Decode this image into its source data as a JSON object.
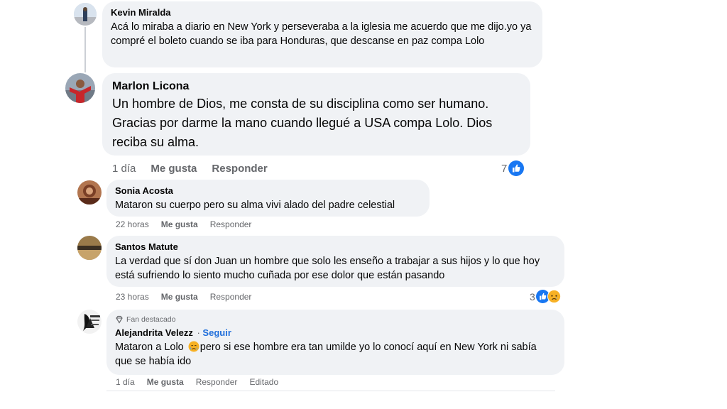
{
  "comments": [
    {
      "author": "Kevin Miralda",
      "text": "Acá lo miraba a diario en New York y perseveraba a la iglesia me acuerdo que me dijo.yo ya compré el boleto cuando se iba para Honduras, que descanse en paz compa Lolo"
    },
    {
      "author": "Marlon Licona",
      "text": "Un hombre de Dios, me consta de su disciplina como ser humano. Gracias por darme la mano cuando llegué a USA compa Lolo. Dios reciba su alma.",
      "time": "1 día",
      "like": "Me gusta",
      "reply": "Responder",
      "reaction_count": "7",
      "reaction_icons": [
        "like-icon"
      ]
    },
    {
      "author": "Sonia Acosta",
      "text": "Mataron su cuerpo pero su alma vivi alado del padre celestial",
      "time": "22 horas",
      "like": "Me gusta",
      "reply": "Responder"
    },
    {
      "author": "Santos Matute",
      "text": "La verdad que sí don Juan un hombre que solo les enseño a trabajar a sus hijos y lo que hoy está sufriendo lo siento mucho cuñada por ese dolor que están pasando",
      "time": "23 horas",
      "like": "Me gusta",
      "reply": "Responder",
      "reaction_count": "3",
      "reaction_icons": [
        "like-icon",
        "sad-icon"
      ]
    },
    {
      "badge": "Fan destacado",
      "author": "Alejandrita Velezz",
      "follow_sep": "·",
      "follow": "Seguir",
      "text_part1": "Mataron a Lolo",
      "emoji": "crying-face-icon",
      "text_part2": "pero si ese hombre era tan umilde yo lo conocí aquí en New York ni sabía que se había ido",
      "time": "1 día",
      "like": "Me gusta",
      "reply": "Responder",
      "edited": "Editado"
    }
  ],
  "colors": {
    "bubble": "#f0f2f5",
    "text": "#050505",
    "meta": "#65676b",
    "like_blue": "#1877f2",
    "follow_blue": "#216fdb",
    "sad_yellow": "#f7b125"
  }
}
